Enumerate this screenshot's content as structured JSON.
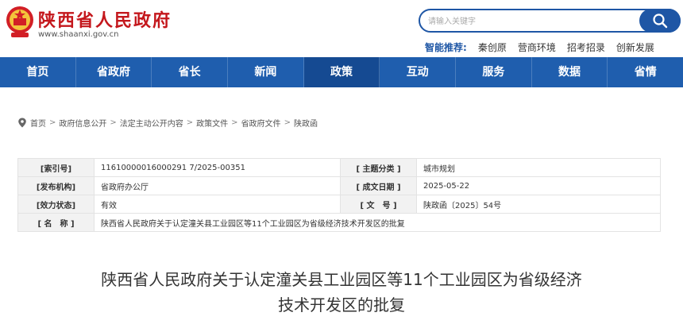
{
  "header": {
    "site_title": "陕西省人民政府",
    "site_domain": "www.shaanxi.gov.cn",
    "emblem_icon": "national-emblem-icon",
    "search": {
      "placeholder": "请输入关键字",
      "icon": "search-icon"
    },
    "hot": {
      "label": "智能推荐:",
      "items": [
        "秦创原",
        "营商环境",
        "招考招录",
        "创新发展"
      ]
    }
  },
  "nav": {
    "items": [
      "首页",
      "省政府",
      "省长",
      "新闻",
      "政策",
      "互动",
      "服务",
      "数据",
      "省情"
    ],
    "active_index": 4
  },
  "breadcrumb": {
    "icon": "location-pin-icon",
    "items": [
      "首页",
      "政府信息公开",
      "法定主动公开内容",
      "政策文件",
      "省政府文件",
      "陕政函"
    ],
    "separator": ">"
  },
  "info": {
    "rows": [
      {
        "l1": "[索引号]",
        "v1": "11610000016000291 7/2025-00351",
        "l2": "[ 主题分类 ]",
        "v2": "城市规划"
      },
      {
        "l1": "[发布机构]",
        "v1": "省政府办公厅",
        "l2": "[ 成文日期 ]",
        "v2": "2025-05-22"
      },
      {
        "l1": "[效力状态]",
        "v1": "有效",
        "l2": "[ 文　号 ]",
        "v2": "陕政函〔2025〕54号"
      }
    ],
    "name_label": "[ 名　称 ]",
    "name_value": "陕西省人民政府关于认定潼关县工业园区等11个工业园区为省级经济技术开发区的批复"
  },
  "doc_title": {
    "line1": "陕西省人民政府关于认定潼关县工业园区等11个工业园区为省级经济",
    "line2": "技术开发区的批复"
  },
  "colors": {
    "brand_red": "#c4171c",
    "nav_blue": "#1f5eae",
    "nav_active": "#154a92"
  }
}
